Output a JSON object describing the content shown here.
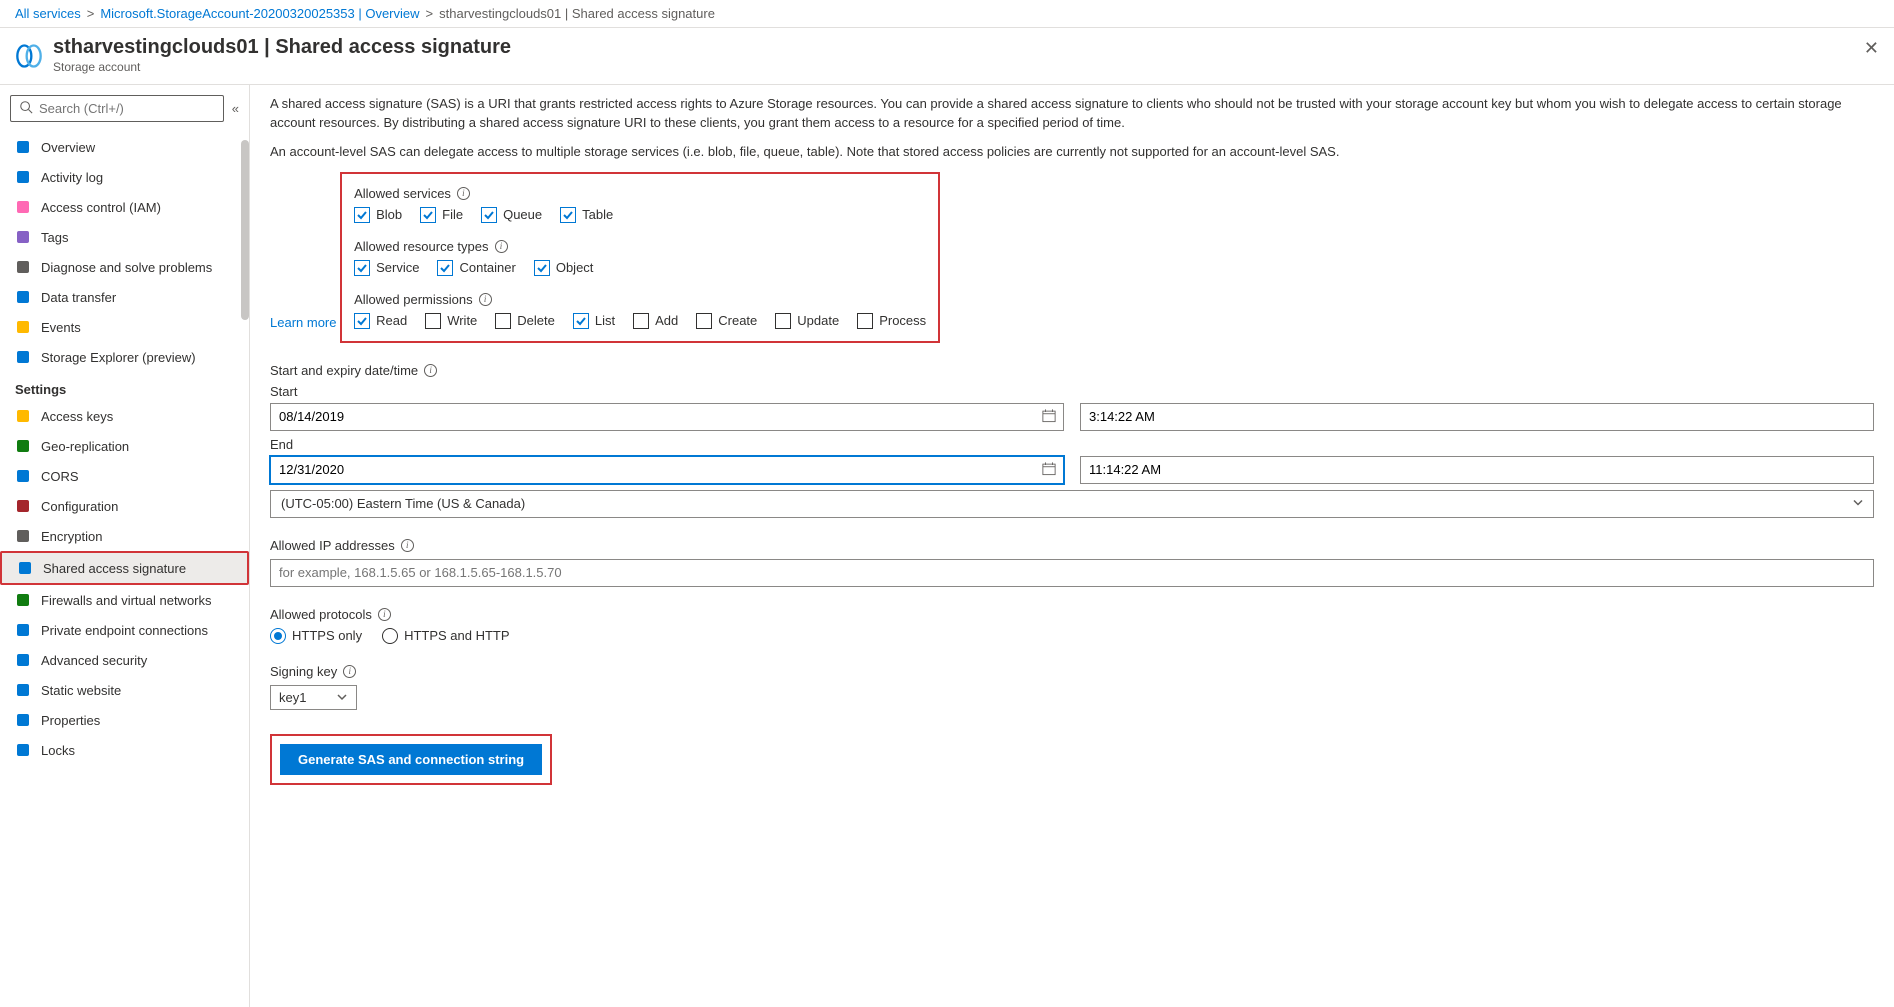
{
  "breadcrumb": {
    "root": "All services",
    "mid": "Microsoft.StorageAccount-20200320025353 | Overview",
    "current": "stharvestingclouds01 | Shared access signature"
  },
  "header": {
    "title": "stharvestingclouds01 | Shared access signature",
    "subtitle": "Storage account"
  },
  "search": {
    "placeholder": "Search (Ctrl+/)"
  },
  "nav": {
    "top": [
      {
        "label": "Overview",
        "color": "#0078d4"
      },
      {
        "label": "Activity log",
        "color": "#0078d4"
      },
      {
        "label": "Access control (IAM)",
        "color": "#ff69b4"
      },
      {
        "label": "Tags",
        "color": "#8661c5"
      },
      {
        "label": "Diagnose and solve problems",
        "color": "#605e5c"
      },
      {
        "label": "Data transfer",
        "color": "#0078d4"
      },
      {
        "label": "Events",
        "color": "#ffb900"
      },
      {
        "label": "Storage Explorer (preview)",
        "color": "#0078d4"
      }
    ],
    "section": "Settings",
    "settings": [
      {
        "label": "Access keys",
        "color": "#ffb900"
      },
      {
        "label": "Geo-replication",
        "color": "#107c10"
      },
      {
        "label": "CORS",
        "color": "#0078d4"
      },
      {
        "label": "Configuration",
        "color": "#a4262c"
      },
      {
        "label": "Encryption",
        "color": "#605e5c"
      },
      {
        "label": "Shared access signature",
        "color": "#0078d4",
        "selected": true,
        "highlight": true
      },
      {
        "label": "Firewalls and virtual networks",
        "color": "#107c10"
      },
      {
        "label": "Private endpoint connections",
        "color": "#0078d4"
      },
      {
        "label": "Advanced security",
        "color": "#0078d4"
      },
      {
        "label": "Static website",
        "color": "#0078d4"
      },
      {
        "label": "Properties",
        "color": "#0078d4"
      },
      {
        "label": "Locks",
        "color": "#0078d4"
      }
    ]
  },
  "main": {
    "para1": "A shared access signature (SAS) is a URI that grants restricted access rights to Azure Storage resources. You can provide a shared access signature to clients who should not be trusted with your storage account key but whom you wish to delegate access to certain storage account resources. By distributing a shared access signature URI to these clients, you grant them access to a resource for a specified period of time.",
    "para2": "An account-level SAS can delegate access to multiple storage services (i.e. blob, file, queue, table). Note that stored access policies are currently not supported for an account-level SAS.",
    "learn": "Learn more",
    "allowed_services_label": "Allowed services",
    "services": [
      {
        "label": "Blob",
        "checked": true
      },
      {
        "label": "File",
        "checked": true
      },
      {
        "label": "Queue",
        "checked": true
      },
      {
        "label": "Table",
        "checked": true
      }
    ],
    "allowed_resource_label": "Allowed resource types",
    "resources": [
      {
        "label": "Service",
        "checked": true
      },
      {
        "label": "Container",
        "checked": true
      },
      {
        "label": "Object",
        "checked": true
      }
    ],
    "allowed_perm_label": "Allowed permissions",
    "perms": [
      {
        "label": "Read",
        "checked": true
      },
      {
        "label": "Write",
        "checked": false
      },
      {
        "label": "Delete",
        "checked": false
      },
      {
        "label": "List",
        "checked": true
      },
      {
        "label": "Add",
        "checked": false
      },
      {
        "label": "Create",
        "checked": false
      },
      {
        "label": "Update",
        "checked": false
      },
      {
        "label": "Process",
        "checked": false
      }
    ],
    "datetime_label": "Start and expiry date/time",
    "start_label": "Start",
    "end_label": "End",
    "start_date": "08/14/2019",
    "start_time": "3:14:22 AM",
    "end_date": "12/31/2020",
    "end_time": "11:14:22 AM",
    "timezone": "(UTC-05:00) Eastern Time (US & Canada)",
    "ip_label": "Allowed IP addresses",
    "ip_placeholder": "for example, 168.1.5.65 or 168.1.5.65-168.1.5.70",
    "proto_label": "Allowed protocols",
    "proto_https": "HTTPS only",
    "proto_both": "HTTPS and HTTP",
    "key_label": "Signing key",
    "key_value": "key1",
    "generate": "Generate SAS and connection string"
  }
}
